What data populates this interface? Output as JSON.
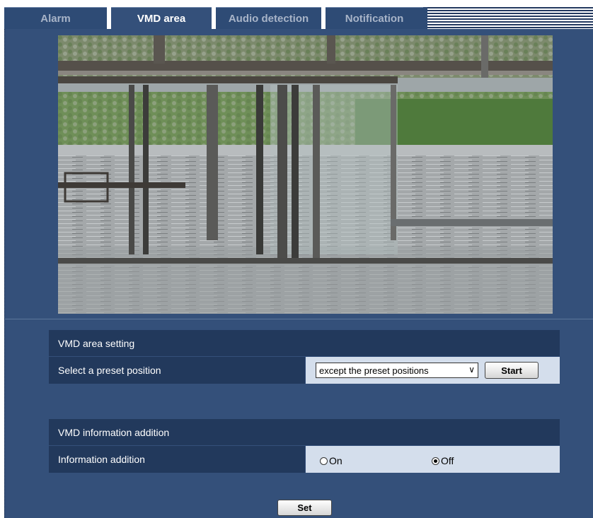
{
  "tabs": [
    {
      "label": "Alarm",
      "active": false
    },
    {
      "label": "VMD area",
      "active": true
    },
    {
      "label": "Audio detection",
      "active": false
    },
    {
      "label": "Notification",
      "active": false
    }
  ],
  "camera_preview": {
    "description_icon": "camera-preview-image"
  },
  "vmd_area_setting": {
    "heading": "VMD area setting",
    "preset_label": "Select a preset position",
    "preset_selected": "except the preset positions",
    "start_button": "Start"
  },
  "vmd_information_addition": {
    "heading": "VMD information addition",
    "info_label": "Information addition",
    "option_on": "On",
    "option_off": "Off",
    "selected": "Off"
  },
  "set_button": "Set",
  "colors": {
    "panel": "#34507a",
    "header": "#22395c",
    "value_cell": "#d4deec"
  }
}
